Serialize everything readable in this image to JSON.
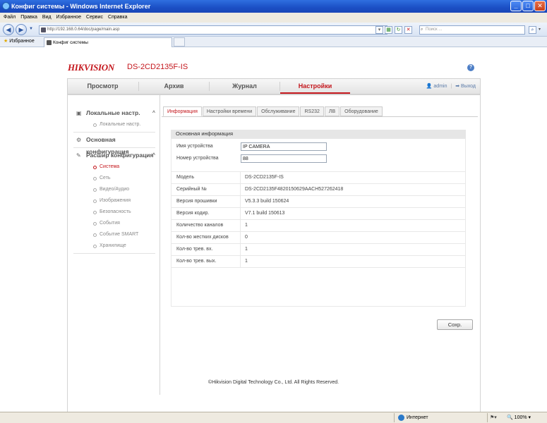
{
  "window": {
    "title": "Конфиг системы - Windows Internet Explorer",
    "controls": [
      "_",
      "□",
      "✕"
    ]
  },
  "menubar": [
    "Файл",
    "Правка",
    "Вид",
    "Избранное",
    "Сервис",
    "Справка"
  ],
  "address": {
    "url": "http://192.168.0.64/doc/page/main.asp",
    "search_placeholder": "Поиск ..."
  },
  "favorites": {
    "label": "Избранное",
    "tab_title": "Конфиг системы"
  },
  "header": {
    "brand": "HIKVISION",
    "model": "DS-2CD2135F-IS",
    "help": "?"
  },
  "nav": {
    "items": [
      "Просмотр",
      "Архив",
      "Журнал",
      "Настройки"
    ],
    "active": 3,
    "user": "admin",
    "separator": "|",
    "logout": "Выход"
  },
  "sidebar": {
    "local": {
      "title": "Локальные настр.",
      "items": [
        "Локальные настр."
      ]
    },
    "basic": {
      "title": "Основная конфигурация"
    },
    "advanced": {
      "title": "Расшир конфигурация",
      "items": [
        "Система",
        "Сеть",
        "Видео/Аудио",
        "Изображения",
        "Безопасность",
        "События",
        "Событие SMART",
        "Хранилище"
      ],
      "active": 0
    }
  },
  "tabs": {
    "items": [
      "Информация",
      "Настройки времени",
      "Обслуживание",
      "RS232",
      "ЛВ",
      "Оборудование"
    ],
    "active": 0
  },
  "section": {
    "title": "Основная информация"
  },
  "fields": {
    "device_name": {
      "label": "Имя устройства",
      "value": "IP CAMERA"
    },
    "device_no": {
      "label": "Номер устройства",
      "value": "88"
    }
  },
  "info": [
    {
      "label": "Модель",
      "value": "DS-2CD2135F-IS"
    },
    {
      "label": "Серийный №",
      "value": "DS-2CD2135F4820150629AACH527262418"
    },
    {
      "label": "Версия прошивки",
      "value": "V5.3.3 build 150624"
    },
    {
      "label": "Версия кодир.",
      "value": "V7.1 build 150613"
    },
    {
      "label": "Количество каналов",
      "value": "1"
    },
    {
      "label": "Кол-во жестких дисков",
      "value": "0"
    },
    {
      "label": "Кол-во трев. вх.",
      "value": "1"
    },
    {
      "label": "Кол-во трев. вых.",
      "value": "1"
    }
  ],
  "save": "Сохр.",
  "footer": "©Hikvision Digital Technology Co., Ltd. All Rights Reserved.",
  "status": {
    "zone": "Интернет",
    "zoom": "100%"
  },
  "colors": {
    "accent": "#c4161c",
    "titlebar": "#1b4fc4"
  }
}
